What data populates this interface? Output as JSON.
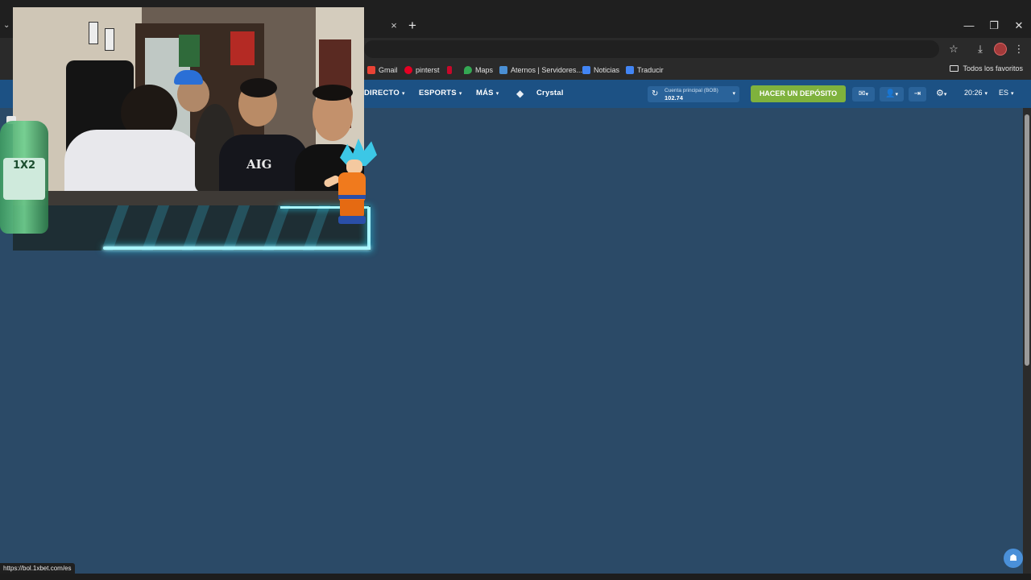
{
  "browser": {
    "tab_close": "×",
    "new_tab": "+",
    "window_controls": [
      "—",
      "❐",
      "✕"
    ],
    "bookmarks": [
      {
        "label": "Gmail",
        "icon": "gmail-icon",
        "color": "#ea4335"
      },
      {
        "label": "pinterst",
        "icon": "pinterest-icon",
        "color": "#e60023"
      },
      {
        "label": "",
        "icon": "nba-icon",
        "color": "#c9082a"
      },
      {
        "label": "Maps",
        "icon": "maps-icon",
        "color": "#34a853"
      },
      {
        "label": "Aternos | Servidores...",
        "icon": "aternos-icon",
        "color": "#4a8fd4"
      },
      {
        "label": "Noticias",
        "icon": "news-icon",
        "color": "#4285f4"
      },
      {
        "label": "Traducir",
        "icon": "translate-icon",
        "color": "#4285f4"
      }
    ],
    "all_bookmarks": "Todos los favoritos",
    "status_url": "https://bol.1xbet.com/es"
  },
  "site": {
    "nav": [
      {
        "label": "DIRECTO"
      },
      {
        "label": "ESPORTS"
      },
      {
        "label": "MÁS"
      }
    ],
    "crystal_label": "Crystal",
    "account": {
      "label": "Cuenta principal (BOB)",
      "balance": "102.74"
    },
    "deposit_label": "HACER UN DEPÓSITO",
    "time": "20:26",
    "language": "ES"
  },
  "overlay": {
    "shirt_text": "AIG",
    "bottle_text": "1X2"
  },
  "colors": {
    "site_nav": "#1c5184",
    "page_bg": "#2b4a67",
    "deposit": "#7fb23d",
    "neon": "#29e0ff"
  }
}
